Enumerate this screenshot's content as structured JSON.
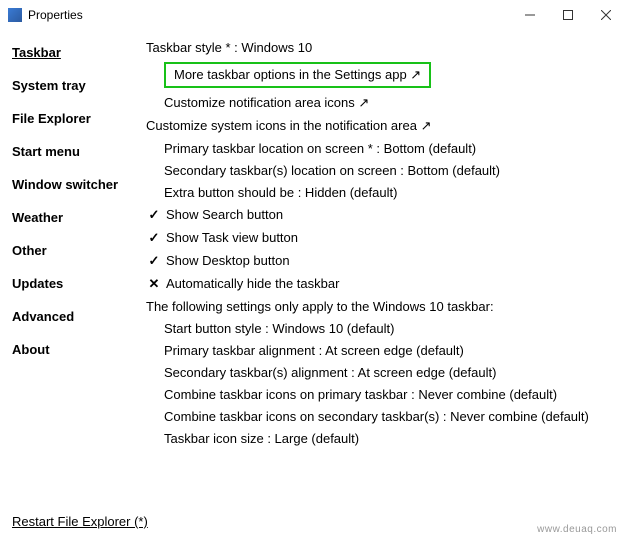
{
  "window": {
    "title": "Properties"
  },
  "sidebar": {
    "items": [
      {
        "label": "Taskbar"
      },
      {
        "label": "System tray"
      },
      {
        "label": "File Explorer"
      },
      {
        "label": "Start menu"
      },
      {
        "label": "Window switcher"
      },
      {
        "label": "Weather"
      },
      {
        "label": "Other"
      },
      {
        "label": "Updates"
      },
      {
        "label": "Advanced"
      },
      {
        "label": "About"
      }
    ]
  },
  "main": {
    "taskbar_style": "Taskbar style * : Windows 10",
    "settings_link": "More taskbar options in the Settings app ↗",
    "notif_icons_link": "Customize notification area icons ↗",
    "system_icons_link": "Customize system icons in the notification area ↗",
    "primary_location": "Primary taskbar location on screen * : Bottom (default)",
    "secondary_location": "Secondary taskbar(s) location on screen : Bottom (default)",
    "extra_button": "Extra button should be : Hidden (default)",
    "show_search": "Show Search button",
    "show_taskview": "Show Task view button",
    "show_desktop": "Show Desktop button",
    "auto_hide": "Automatically hide the taskbar",
    "note": "The following settings only apply to the Windows 10 taskbar:",
    "start_style": "Start button style : Windows 10 (default)",
    "primary_align": "Primary taskbar alignment : At screen edge (default)",
    "secondary_align": "Secondary taskbar(s) alignment : At screen edge (default)",
    "combine_primary": "Combine taskbar icons on primary taskbar : Never combine (default)",
    "combine_secondary": "Combine taskbar icons on secondary taskbar(s) : Never combine (default)",
    "icon_size": "Taskbar icon size : Large (default)"
  },
  "footer": {
    "restart": "Restart File Explorer (*)"
  },
  "watermark": "www.deuaq.com"
}
